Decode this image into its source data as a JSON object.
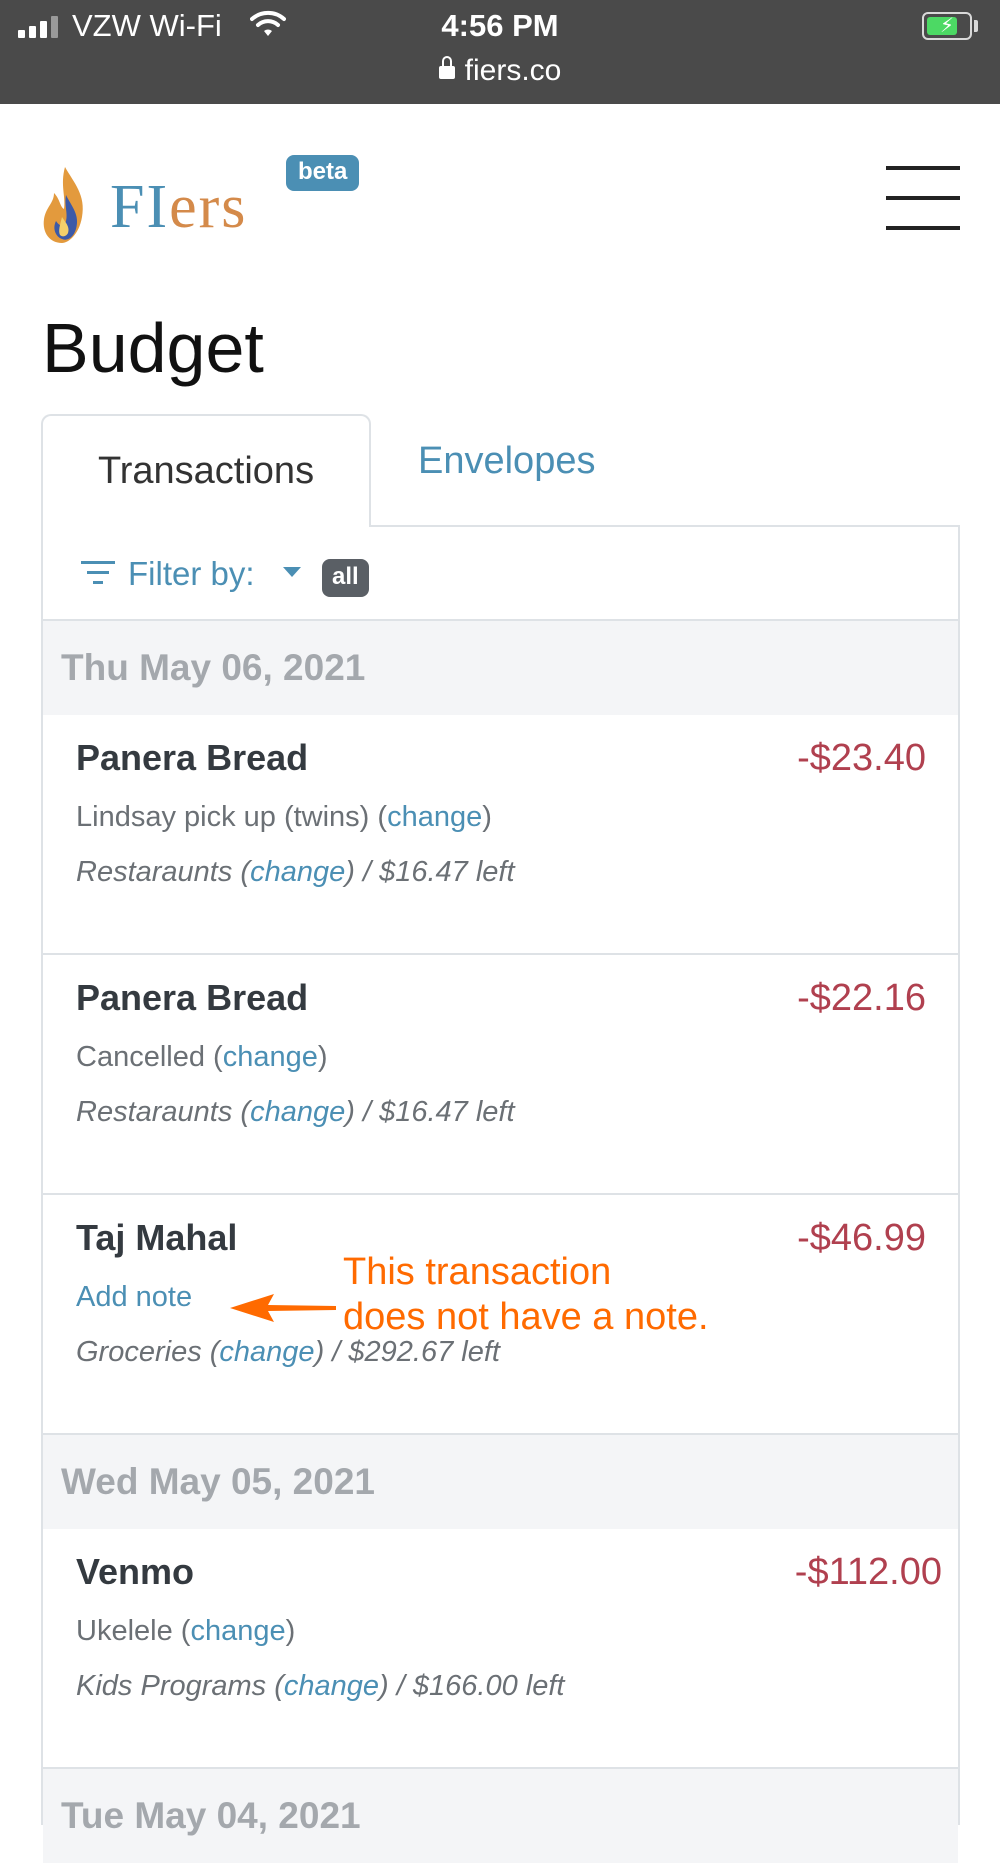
{
  "status_bar": {
    "carrier": "VZW Wi-Fi",
    "time": "4:56 PM",
    "url": "fiers.co",
    "battery_state": "charging"
  },
  "header": {
    "brand_prefix": "FI",
    "brand_suffix": "ers",
    "badge": "beta",
    "menu_icon": "hamburger-icon"
  },
  "page": {
    "title": "Budget"
  },
  "tabs": [
    {
      "label": "Transactions",
      "active": true
    },
    {
      "label": "Envelopes",
      "active": false
    }
  ],
  "filter": {
    "label": "Filter by:",
    "value": "all"
  },
  "groups": [
    {
      "date": "Thu May 06, 2021",
      "transactions": [
        {
          "merchant": "Panera Bread",
          "amount": "-$23.40",
          "note": "Lindsay pick up (twins)",
          "note_link": "change",
          "category": "Restaraunts",
          "category_link": "change",
          "remaining": "/ $16.47 left"
        },
        {
          "merchant": "Panera Bread",
          "amount": "-$22.16",
          "note": "Cancelled",
          "note_link": "change",
          "category": "Restaraunts",
          "category_link": "change",
          "remaining": "/ $16.47 left"
        },
        {
          "merchant": "Taj Mahal",
          "amount": "-$46.99",
          "add_note": "Add note",
          "category": "Groceries",
          "category_link": "change",
          "remaining": "/ $292.67 left"
        }
      ]
    },
    {
      "date": "Wed May 05, 2021",
      "transactions": [
        {
          "merchant": "Venmo",
          "amount": "-$112.00",
          "note": "Ukelele",
          "note_link": "change",
          "category": "Kids Programs",
          "category_link": "change",
          "remaining": "/ $166.00 left"
        }
      ]
    },
    {
      "date": "Tue May 04, 2021"
    }
  ],
  "annotation": {
    "line1": "This transaction",
    "line2": "does not have a note.",
    "color": "#ff6a00"
  },
  "colors": {
    "accent": "#4b8fb4",
    "amount": "#b0404f",
    "brand_orange": "#d48a4a"
  }
}
